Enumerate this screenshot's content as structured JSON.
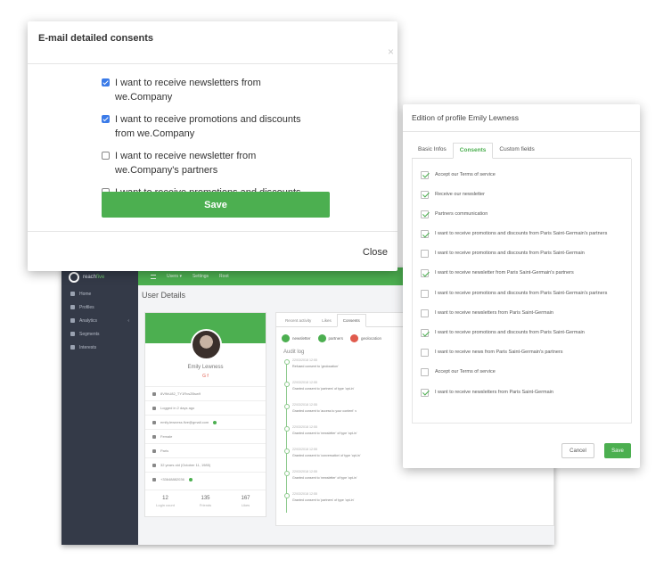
{
  "app": {
    "brand_prefix": "reach",
    "brand_suffix": "five",
    "nav": [
      {
        "label": "Home"
      },
      {
        "label": "Profiles"
      },
      {
        "label": "Analytics"
      },
      {
        "label": "Segments"
      },
      {
        "label": "Interests"
      }
    ],
    "topbar": [
      "Users ▾",
      "Settings",
      "Root"
    ],
    "heading": "User Details",
    "profile": {
      "name": "Emily Lewness",
      "social": "G f",
      "info": [
        "8V9bU82_TY1Rvs2Bsw9",
        "Logged in 2 days ago",
        "emily.lewness.five@gmail.com",
        "Female",
        "Paris",
        "32 years old (October 11, 1985)",
        "+33648882036"
      ],
      "stats": [
        {
          "value": "12",
          "label": "Login count"
        },
        {
          "value": "135",
          "label": "Friends"
        },
        {
          "value": "167",
          "label": "Likes"
        }
      ]
    },
    "activity": {
      "tabs": [
        "Recent activity",
        "Likes",
        "Consents"
      ],
      "chips": [
        {
          "label": "newsletter",
          "state": "ok"
        },
        {
          "label": "partners",
          "state": "ok"
        },
        {
          "label": "geolocation",
          "state": "refused"
        }
      ],
      "audit_title": "Audit log",
      "entries": [
        {
          "date": "22/03/2018 12:55",
          "text": "Refused consent to 'geolocation'"
        },
        {
          "date": "22/03/2018 12:55",
          "text": "Granted consent to 'partners' of type 'opt-in'"
        },
        {
          "date": "22/03/2018 12:55",
          "text": "Granted consent to 'access to your content' ∨"
        },
        {
          "date": "22/03/2018 12:55",
          "text": "Granted consent to 'newsletter' of type 'opt-in'"
        },
        {
          "date": "22/03/2018 12:55",
          "text": "Granted consent to 'conversation' of type 'opt-in'"
        },
        {
          "date": "22/03/2018 12:55",
          "text": "Granted consent to 'newsletter' of type 'opt-in'"
        },
        {
          "date": "22/03/2018 12:55",
          "text": "Granted consent to 'partners' of type 'opt-in'"
        }
      ]
    }
  },
  "email_modal": {
    "title": "E-mail detailed consents",
    "close_x": "×",
    "options": [
      {
        "label": "I want to receive newsletters from we.Company",
        "checked": true
      },
      {
        "label": "I want to receive promotions and discounts from we.Company",
        "checked": true
      },
      {
        "label": "I want to receive newsletter from we.Company's partners",
        "checked": false
      },
      {
        "label": "I want to receive promotions and discounts from we.Company",
        "checked": false
      }
    ],
    "save_label": "Save",
    "close_label": "Close"
  },
  "profile_modal": {
    "title": "Edition of profile Emily Lewness",
    "tabs": [
      {
        "label": "Basic Infos",
        "active": false
      },
      {
        "label": "Consents",
        "active": true
      },
      {
        "label": "Custom fields",
        "active": false
      }
    ],
    "consents": [
      {
        "label": "Accept our Terms of service",
        "checked": true
      },
      {
        "label": "Receive our newsletter",
        "checked": true
      },
      {
        "label": "Partners communication",
        "checked": true
      },
      {
        "label": "I want to receive promotions and discounts from Paris Saint-Germain's partners",
        "checked": true
      },
      {
        "label": "I want to receive promotions and discounts from Paris Saint-Germain",
        "checked": false
      },
      {
        "label": "I want to receive newsletter from Paris Saint-Germain's partners",
        "checked": true
      },
      {
        "label": "I want to receive promotions and discounts from Paris Saint-Germain's partners",
        "checked": false
      },
      {
        "label": "I want to receive newsletters from Paris Saint-Germain",
        "checked": false
      },
      {
        "label": "I want to receive promotions and discounts from Paris Saint-Germain",
        "checked": true
      },
      {
        "label": "I want to receive news from Paris Saint-Germain's partners",
        "checked": false
      },
      {
        "label": "Accept our Terms of service",
        "checked": false
      },
      {
        "label": "I want to receive newsletters from Paris Saint-Germain",
        "checked": true
      }
    ],
    "cancel_label": "Cancel",
    "save_label": "Save"
  },
  "colors": {
    "accent": "#4caf50",
    "checkbox_blue": "#3b7be8",
    "sidebar": "#343a48"
  }
}
